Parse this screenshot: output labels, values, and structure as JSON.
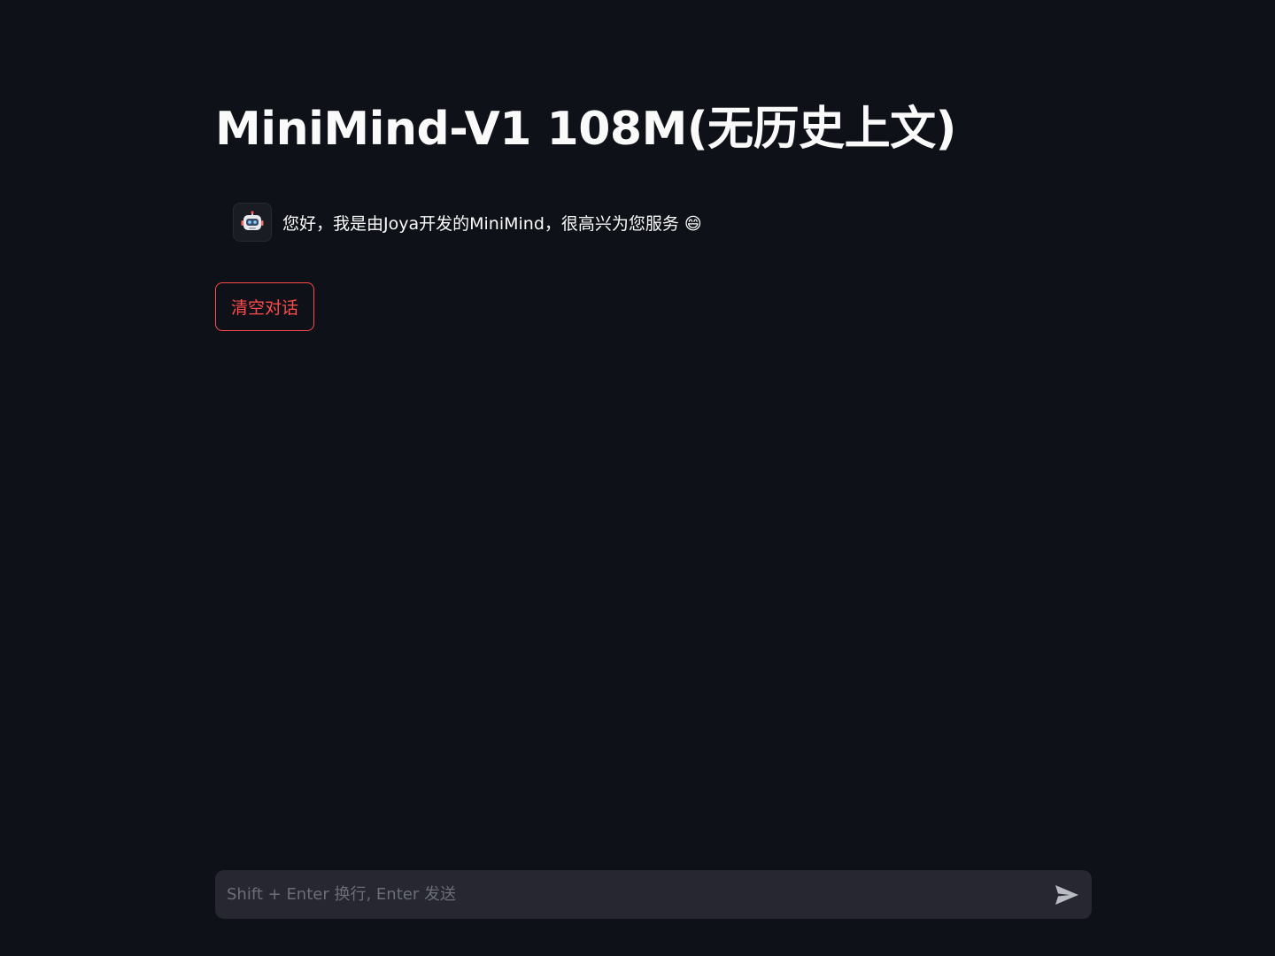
{
  "header": {
    "title": "MiniMind-V1 108M(无历史上文)"
  },
  "chat": {
    "messages": [
      {
        "role": "assistant",
        "avatar_icon": "robot-icon",
        "text": "您好，我是由Joya开发的MiniMind，很高兴为您服务 😄"
      }
    ]
  },
  "actions": {
    "clear_label": "清空对话"
  },
  "input": {
    "value": "",
    "placeholder": "Shift + Enter 换行, Enter 发送",
    "send_icon": "send-icon"
  },
  "colors": {
    "background": "#0e1117",
    "text": "#fafafa",
    "accent": "#ff4b4b",
    "input_background": "#262730"
  }
}
